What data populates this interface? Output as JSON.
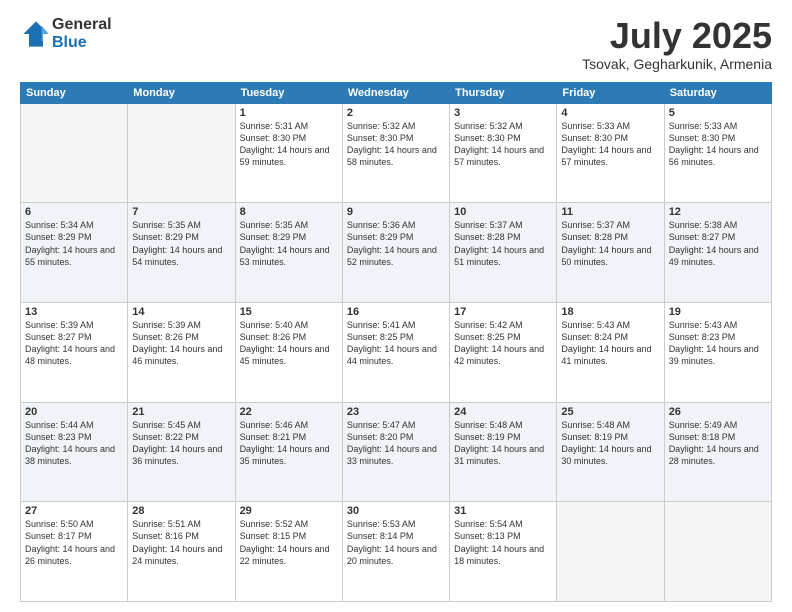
{
  "header": {
    "logo_line1": "General",
    "logo_line2": "Blue",
    "title": "July 2025",
    "location": "Tsovak, Gegharkunik, Armenia"
  },
  "days_of_week": [
    "Sunday",
    "Monday",
    "Tuesday",
    "Wednesday",
    "Thursday",
    "Friday",
    "Saturday"
  ],
  "weeks": [
    [
      {
        "day": "",
        "empty": true
      },
      {
        "day": "",
        "empty": true
      },
      {
        "day": "1",
        "sunrise": "5:31 AM",
        "sunset": "8:30 PM",
        "daylight": "14 hours and 59 minutes."
      },
      {
        "day": "2",
        "sunrise": "5:32 AM",
        "sunset": "8:30 PM",
        "daylight": "14 hours and 58 minutes."
      },
      {
        "day": "3",
        "sunrise": "5:32 AM",
        "sunset": "8:30 PM",
        "daylight": "14 hours and 57 minutes."
      },
      {
        "day": "4",
        "sunrise": "5:33 AM",
        "sunset": "8:30 PM",
        "daylight": "14 hours and 57 minutes."
      },
      {
        "day": "5",
        "sunrise": "5:33 AM",
        "sunset": "8:30 PM",
        "daylight": "14 hours and 56 minutes."
      }
    ],
    [
      {
        "day": "6",
        "sunrise": "5:34 AM",
        "sunset": "8:29 PM",
        "daylight": "14 hours and 55 minutes."
      },
      {
        "day": "7",
        "sunrise": "5:35 AM",
        "sunset": "8:29 PM",
        "daylight": "14 hours and 54 minutes."
      },
      {
        "day": "8",
        "sunrise": "5:35 AM",
        "sunset": "8:29 PM",
        "daylight": "14 hours and 53 minutes."
      },
      {
        "day": "9",
        "sunrise": "5:36 AM",
        "sunset": "8:29 PM",
        "daylight": "14 hours and 52 minutes."
      },
      {
        "day": "10",
        "sunrise": "5:37 AM",
        "sunset": "8:28 PM",
        "daylight": "14 hours and 51 minutes."
      },
      {
        "day": "11",
        "sunrise": "5:37 AM",
        "sunset": "8:28 PM",
        "daylight": "14 hours and 50 minutes."
      },
      {
        "day": "12",
        "sunrise": "5:38 AM",
        "sunset": "8:27 PM",
        "daylight": "14 hours and 49 minutes."
      }
    ],
    [
      {
        "day": "13",
        "sunrise": "5:39 AM",
        "sunset": "8:27 PM",
        "daylight": "14 hours and 48 minutes."
      },
      {
        "day": "14",
        "sunrise": "5:39 AM",
        "sunset": "8:26 PM",
        "daylight": "14 hours and 46 minutes."
      },
      {
        "day": "15",
        "sunrise": "5:40 AM",
        "sunset": "8:26 PM",
        "daylight": "14 hours and 45 minutes."
      },
      {
        "day": "16",
        "sunrise": "5:41 AM",
        "sunset": "8:25 PM",
        "daylight": "14 hours and 44 minutes."
      },
      {
        "day": "17",
        "sunrise": "5:42 AM",
        "sunset": "8:25 PM",
        "daylight": "14 hours and 42 minutes."
      },
      {
        "day": "18",
        "sunrise": "5:43 AM",
        "sunset": "8:24 PM",
        "daylight": "14 hours and 41 minutes."
      },
      {
        "day": "19",
        "sunrise": "5:43 AM",
        "sunset": "8:23 PM",
        "daylight": "14 hours and 39 minutes."
      }
    ],
    [
      {
        "day": "20",
        "sunrise": "5:44 AM",
        "sunset": "8:23 PM",
        "daylight": "14 hours and 38 minutes."
      },
      {
        "day": "21",
        "sunrise": "5:45 AM",
        "sunset": "8:22 PM",
        "daylight": "14 hours and 36 minutes."
      },
      {
        "day": "22",
        "sunrise": "5:46 AM",
        "sunset": "8:21 PM",
        "daylight": "14 hours and 35 minutes."
      },
      {
        "day": "23",
        "sunrise": "5:47 AM",
        "sunset": "8:20 PM",
        "daylight": "14 hours and 33 minutes."
      },
      {
        "day": "24",
        "sunrise": "5:48 AM",
        "sunset": "8:19 PM",
        "daylight": "14 hours and 31 minutes."
      },
      {
        "day": "25",
        "sunrise": "5:48 AM",
        "sunset": "8:19 PM",
        "daylight": "14 hours and 30 minutes."
      },
      {
        "day": "26",
        "sunrise": "5:49 AM",
        "sunset": "8:18 PM",
        "daylight": "14 hours and 28 minutes."
      }
    ],
    [
      {
        "day": "27",
        "sunrise": "5:50 AM",
        "sunset": "8:17 PM",
        "daylight": "14 hours and 26 minutes."
      },
      {
        "day": "28",
        "sunrise": "5:51 AM",
        "sunset": "8:16 PM",
        "daylight": "14 hours and 24 minutes."
      },
      {
        "day": "29",
        "sunrise": "5:52 AM",
        "sunset": "8:15 PM",
        "daylight": "14 hours and 22 minutes."
      },
      {
        "day": "30",
        "sunrise": "5:53 AM",
        "sunset": "8:14 PM",
        "daylight": "14 hours and 20 minutes."
      },
      {
        "day": "31",
        "sunrise": "5:54 AM",
        "sunset": "8:13 PM",
        "daylight": "14 hours and 18 minutes."
      },
      {
        "day": "",
        "empty": true
      },
      {
        "day": "",
        "empty": true
      }
    ]
  ]
}
